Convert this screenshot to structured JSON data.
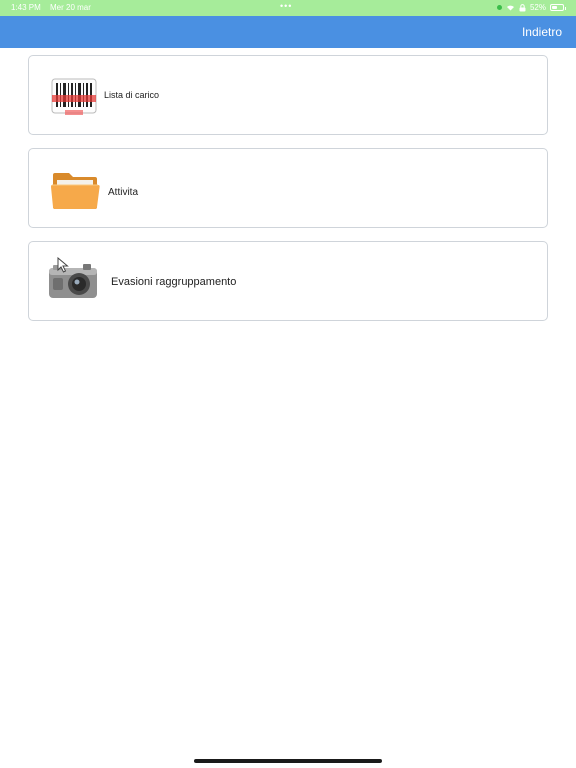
{
  "status_bar": {
    "time": "1:43 PM",
    "date": "Mer 20 mar",
    "dots": "•••",
    "battery": "52%",
    "battery_level": 0.52,
    "background_color": "#a6ec9a"
  },
  "nav_bar": {
    "back_label": "Indietro",
    "background_color": "#4a90e2"
  },
  "menu": {
    "items": [
      {
        "label": "Lista di carico",
        "icon": "barcode-scanner-icon"
      },
      {
        "label": "Attivita",
        "icon": "folder-icon"
      },
      {
        "label": "Evasioni raggruppamento",
        "icon": "camera-icon"
      }
    ]
  }
}
